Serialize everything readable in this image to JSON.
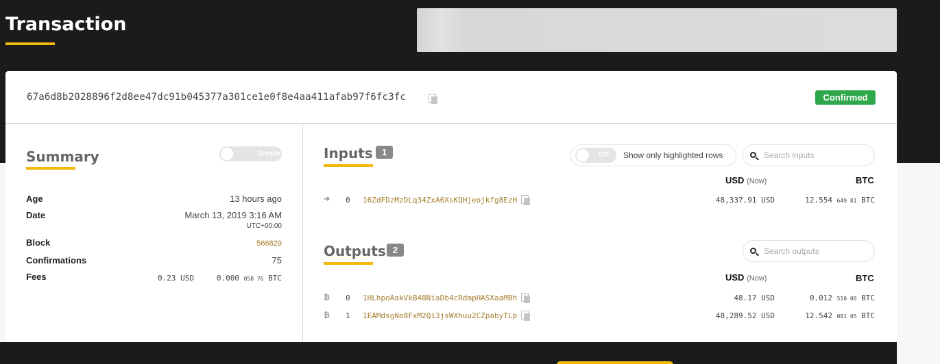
{
  "page": {
    "title": "Transaction"
  },
  "transaction": {
    "hash": "67a6d8b2028896f2d8ee47dc91b045377a301ce1e0f8e4aa411afab97f6fc3fc",
    "status": "Confirmed"
  },
  "summary": {
    "title": "Summary",
    "mode_toggle_label": "Simple",
    "rows": {
      "age": {
        "label": "Age",
        "value": "13 hours ago"
      },
      "date": {
        "label": "Date",
        "value": "March 13, 2019 3:16 AM",
        "sub": "UTC+00:00"
      },
      "block": {
        "label": "Block",
        "value": "566829"
      },
      "confirmations": {
        "label": "Confirmations",
        "value": "75"
      },
      "fees": {
        "label": "Fees",
        "usd": "0.23 USD",
        "btc_main": "0.000",
        "btc_tail": "058 76",
        "btc_unit": "BTC"
      }
    }
  },
  "inputs": {
    "title": "Inputs",
    "count": "1",
    "highlight_toggle_label": "Off",
    "highlight_text": "Show only highlighted rows",
    "search_placeholder": "Search inputs",
    "usd_header": "USD",
    "usd_now": "(Now)",
    "btc_header": "BTC",
    "rows": [
      {
        "index": "0",
        "address": "16ZdFDzMzDLq34ZxA6XsKQHjeojkfg8EzH",
        "usd": "48,337.91 USD",
        "btc_main": "12.554",
        "btc_tail": "649 81",
        "btc_unit": "BTC",
        "icon": "input-arrow-icon"
      }
    ]
  },
  "outputs": {
    "title": "Outputs",
    "count": "2",
    "search_placeholder": "Search outputs",
    "usd_header": "USD",
    "usd_now": "(Now)",
    "btc_header": "BTC",
    "rows": [
      {
        "index": "0",
        "address": "1HLhpoAakVkB48NiaDb4cRdmpHASXaaMBh",
        "usd": "48.17 USD",
        "btc_main": "0.012",
        "btc_tail": "510 00",
        "btc_unit": "BTC",
        "icon": "bitcoin-icon"
      },
      {
        "index": "1",
        "address": "1EAMdsgNo8FxM2Qi3jsWXhuu2CZpabyTLp",
        "usd": "48,289.52 USD",
        "btc_main": "12.542",
        "btc_tail": "081 05",
        "btc_unit": "BTC",
        "icon": "bitcoin-icon"
      }
    ]
  },
  "colors": {
    "accent": "#f0b90b",
    "confirmed": "#2ea84a",
    "link": "#a67c2c",
    "dark_bg": "#1b1b1b"
  }
}
